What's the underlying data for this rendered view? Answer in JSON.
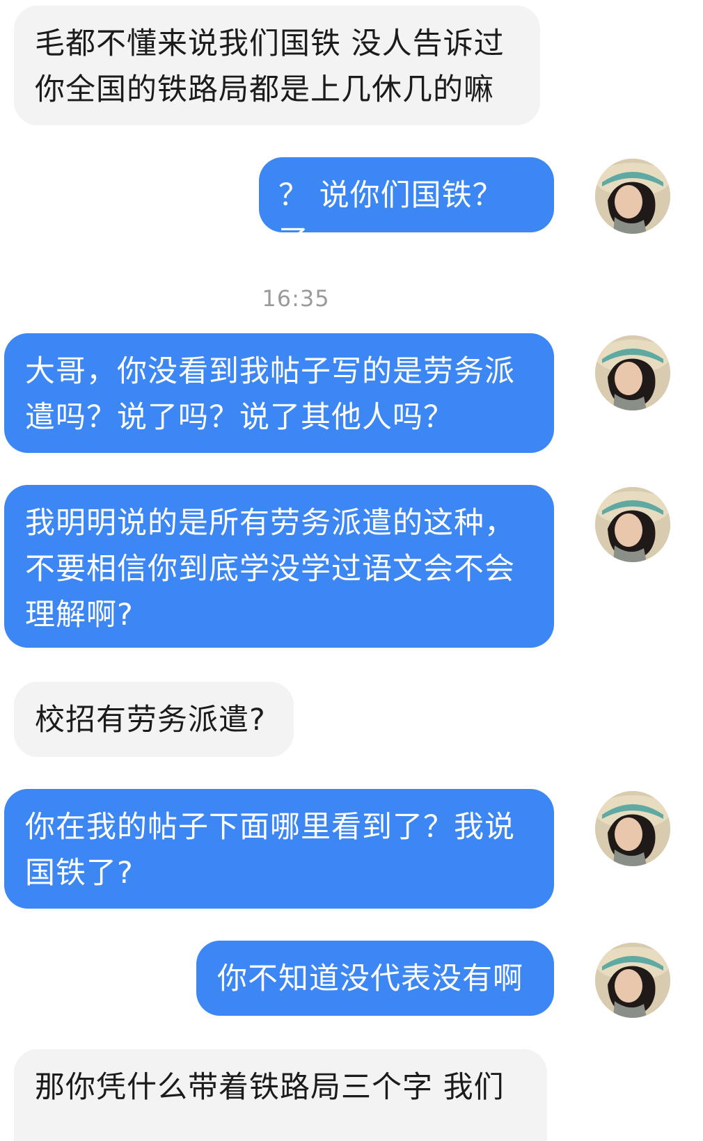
{
  "messages": [
    {
      "side": "received",
      "text": "毛都不懂来说我们国铁 没人告诉过\n你全国的铁路局都是上几休几的嘛"
    },
    {
      "side": "sent",
      "text": "？ 说你们国铁？ 了"
    },
    {
      "side": "sent",
      "text": "大哥，你没看到我帖子写的是劳务派\n遣吗？说了吗？说了其他人吗？"
    },
    {
      "side": "sent",
      "text": "我明明说的是所有劳务派遣的这种，\n不要相信你到底学没学过语文会不会\n理解啊?"
    },
    {
      "side": "received",
      "text": "校招有劳务派遣?"
    },
    {
      "side": "sent",
      "text": "你在我的帖子下面哪里看到了？我说\n国铁了?"
    },
    {
      "side": "sent",
      "text": "你不知道没代表没有啊"
    },
    {
      "side": "received",
      "text": "那你凭什么带着铁路局三个字 我们"
    }
  ],
  "timestamp": "16:35",
  "avatar_icon": "user-avatar-photo",
  "colors": {
    "sent_bubble": "#3d87f5",
    "received_bubble": "#f3f3f4",
    "sent_text": "#ffffff",
    "received_text": "#1b1b1b",
    "timestamp": "#9a9a9a"
  }
}
